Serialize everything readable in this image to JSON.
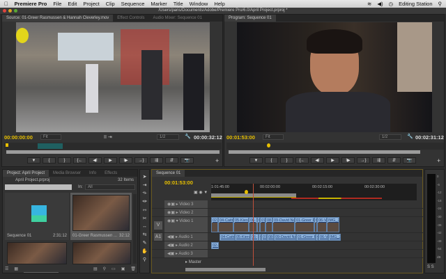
{
  "menubar": {
    "app": "Premiere Pro",
    "items": [
      "File",
      "Edit",
      "Project",
      "Clip",
      "Sequence",
      "Marker",
      "Title",
      "Window",
      "Help"
    ],
    "workspace": "Editing Station"
  },
  "window_title": "/Users/paris/Documents/Adobe/Premiere Pro/6.0/April Project.prproj *",
  "source": {
    "tabs": [
      "Source: 01-Greer Rasmussen & Hannah Cleverley.mov",
      "Effect Controls",
      "Audio Mixer: Sequence 01"
    ],
    "timecode": "00:00:00:00",
    "fit": "Fit",
    "resolution": "1/2",
    "duration": "00:00:32:12"
  },
  "program": {
    "tab": "Program: Sequence 01",
    "timecode": "00:01:53:00",
    "fit": "Fit",
    "resolution": "1/2",
    "duration": "00:02:31:12"
  },
  "transport": [
    "▼",
    "{",
    "}",
    "{←",
    "◀I",
    "▶",
    "I▶",
    "→}",
    "⇶",
    "⇵",
    "📷"
  ],
  "project": {
    "tabs": [
      "Project: April Project",
      "Media Browser",
      "Info",
      "Effects"
    ],
    "file": "April Project.prproj",
    "count": "32 Items",
    "in_label": "In:",
    "in_value": "All",
    "search_placeholder": "",
    "items": [
      {
        "name": "Sequence 01",
        "duration": "2:31:12"
      },
      {
        "name": "01-Greer Rasmussen ...",
        "duration": "32:12"
      },
      {
        "name": "",
        "duration": ""
      },
      {
        "name": "",
        "duration": ""
      }
    ]
  },
  "timeline": {
    "tab": "Sequence 01",
    "timecode": "00:01:53:00",
    "ruler": [
      "1:01:45:00",
      "00:02:00:00",
      "00:02:15:00",
      "00:02:30:00"
    ],
    "tracks": [
      "Video 3",
      "Video 2",
      "Video 1",
      "Audio 1",
      "Audio 2",
      "Audio 3",
      "Master"
    ],
    "v_label": "V",
    "a_label": "A1",
    "video_clips": [
      "02-",
      "04-Caitri",
      "05-Kieran",
      "06-",
      "0",
      "07",
      "08-",
      "09-David Nalde",
      "01-Greer Rasn",
      "C",
      "06-V",
      "IMG_3"
    ],
    "audio_clips": [
      "04-Caitri",
      "05-Kieran",
      "06-",
      "0",
      "07",
      "08-",
      "09-David Nalde",
      "01-Greer Rasn",
      "C",
      "06-V",
      "IMG_3"
    ],
    "audio2_clips": [
      "02-"
    ]
  },
  "meter": {
    "labels": [
      "0",
      "-6",
      "-12",
      "-18",
      "-24",
      "-30",
      "-36",
      "-42",
      "-48",
      "-54",
      "dB"
    ]
  }
}
